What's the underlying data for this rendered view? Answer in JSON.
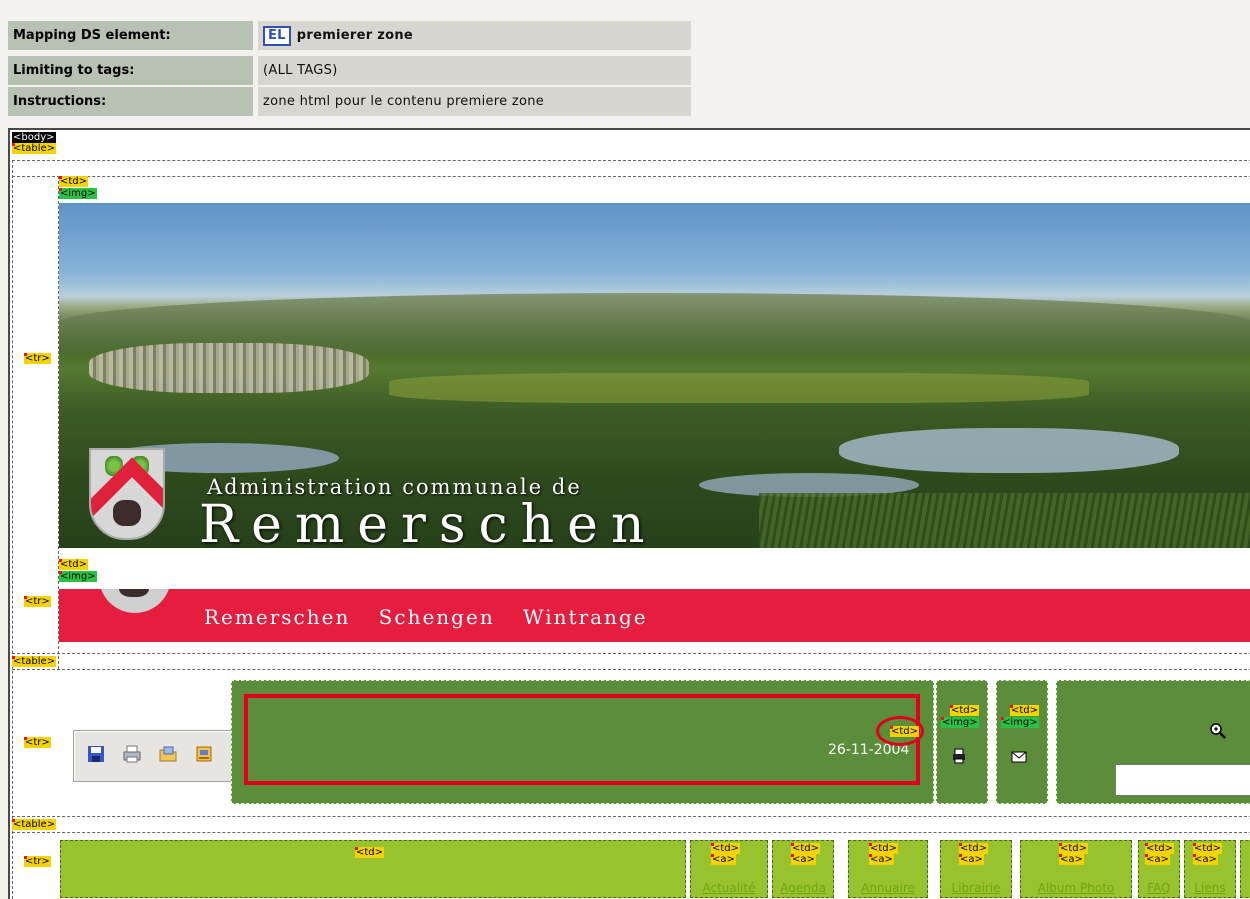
{
  "mapping": {
    "rows": [
      {
        "key": "Mapping DS element:",
        "badge": "EL",
        "value": "premierer zone"
      },
      {
        "key": "Limiting to tags:",
        "value": "(ALL TAGS)"
      },
      {
        "key": "Instructions:",
        "value": "zone html pour le contenu premiere zone"
      }
    ]
  },
  "tags": {
    "body": "<body>",
    "table": "<table>",
    "tr": "<tr>",
    "td": "<td>",
    "img": "<img>",
    "a": "<a>"
  },
  "banner": {
    "admin_line": "Administration communale de",
    "town": "Remerschen"
  },
  "red_band": {
    "villages": "Remerschen   Schengen   Wintrange"
  },
  "toolbar": {
    "date": "26-11-2004",
    "icons": [
      "save-icon",
      "print-icon",
      "open-folder-icon",
      "export-icon"
    ]
  },
  "nav": {
    "links": [
      "Actualité",
      "Agenda",
      "Annuaire",
      "Librairie",
      "Album Photo",
      "FAQ",
      "Liens"
    ]
  },
  "colors": {
    "highlight": "#e0001b",
    "tag_td": "#f4d300",
    "tag_img": "#25c244",
    "green_cell": "#5b8d3a",
    "lime_cell": "#99c32e",
    "red_band": "#e51d3e"
  }
}
